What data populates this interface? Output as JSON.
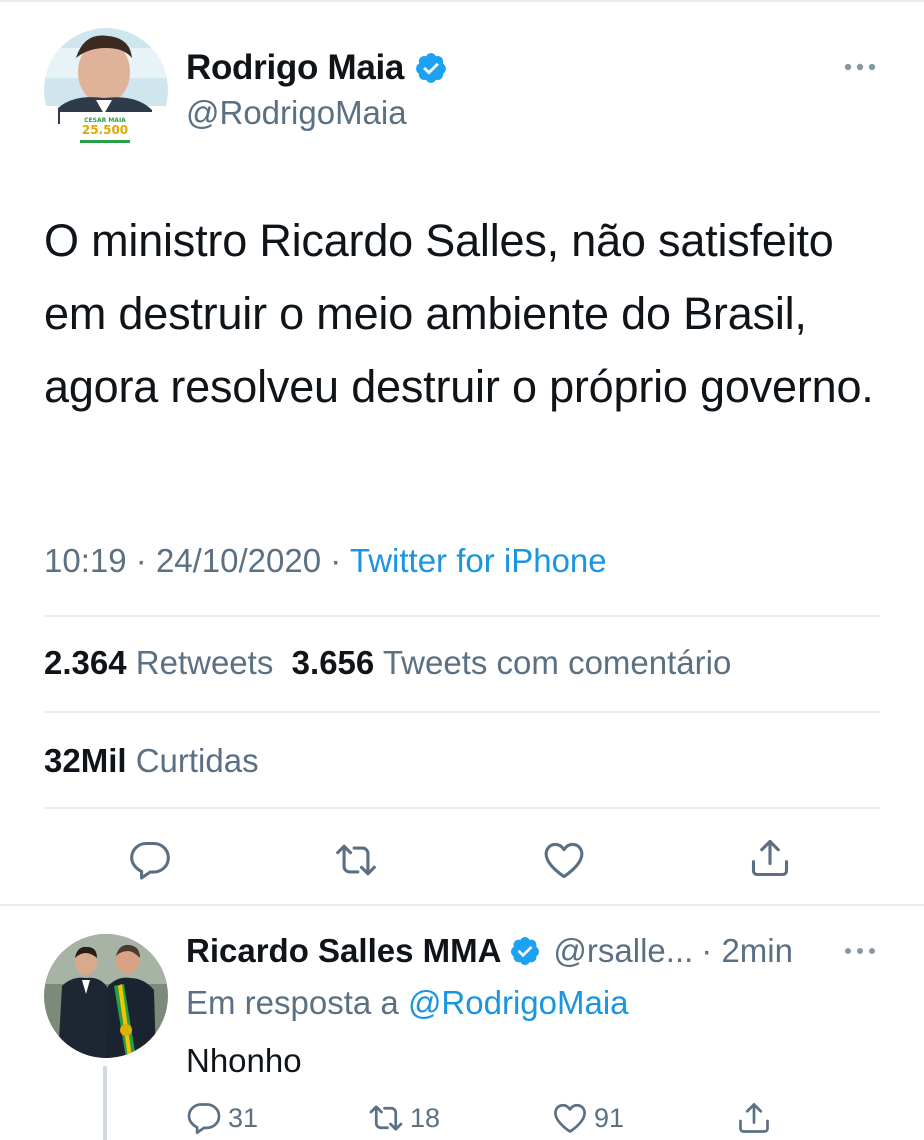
{
  "tweet": {
    "author_name": "Rodrigo Maia",
    "author_handle": "@RodrigoMaia",
    "avatar_badge": "CESAR MAIA 25.500",
    "text": "O ministro Ricardo Salles, não satisfeito em destruir o meio ambiente do Brasil, agora resolveu destruir o próprio governo.",
    "time": "10:19",
    "date": "24/10/2020",
    "separator": "·",
    "source": "Twitter for iPhone",
    "retweets_count": "2.364",
    "retweets_label": "Retweets",
    "quotes_count": "3.656",
    "quotes_label": "Tweets com comentário",
    "likes_count": "32Mil",
    "likes_label": "Curtidas"
  },
  "reply": {
    "author_name": "Ricardo Salles MMA",
    "author_handle": "@rsalle...",
    "time": "· 2min",
    "reply_prefix": "Em resposta a",
    "reply_mention": "@RodrigoMaia",
    "text": "Nhonho",
    "reply_count": "31",
    "retweet_count": "18",
    "like_count": "91"
  },
  "icons": {
    "verified": "verified-badge-icon",
    "more": "more-options-icon",
    "reply": "reply-icon",
    "retweet": "retweet-icon",
    "like": "heart-icon",
    "share": "share-icon"
  },
  "colors": {
    "accent": "#1b95e0",
    "verified": "#1da1f2",
    "muted": "#5b7083",
    "text": "#0f1419",
    "divider": "#e6ecf0"
  }
}
